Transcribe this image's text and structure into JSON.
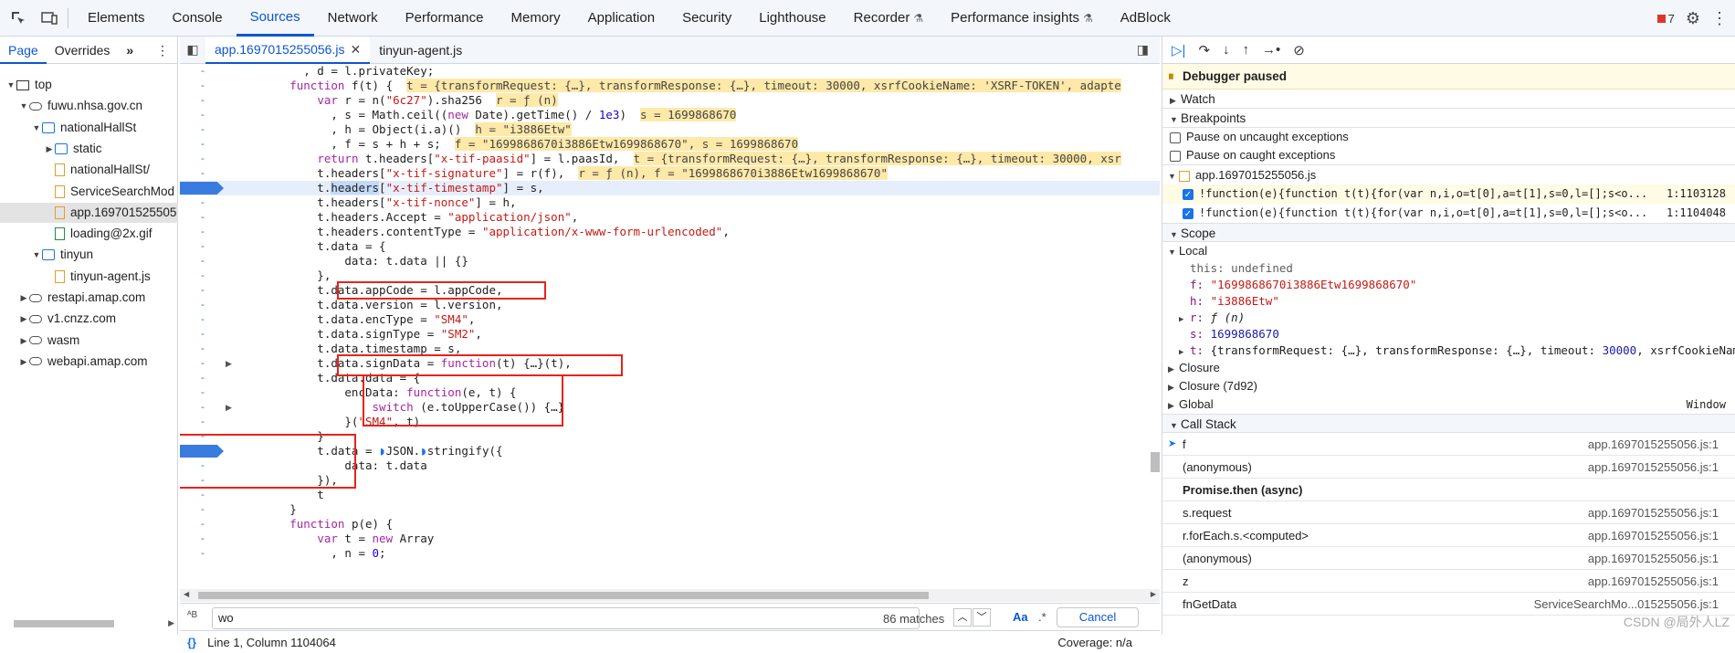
{
  "toolbar": {
    "tabs": [
      "Elements",
      "Console",
      "Sources",
      "Network",
      "Performance",
      "Memory",
      "Application",
      "Security",
      "Lighthouse",
      "Recorder",
      "Performance insights",
      "AdBlock"
    ],
    "active_tab": "Sources",
    "error_count": "7"
  },
  "navigator": {
    "tabs": [
      "Page",
      "Overrides"
    ],
    "tree": [
      {
        "label": "top",
        "indent": 0,
        "icon": "frame",
        "arrow": "▼"
      },
      {
        "label": "fuwu.nhsa.gov.cn",
        "indent": 1,
        "icon": "cloud",
        "arrow": "▼"
      },
      {
        "label": "nationalHallSt",
        "indent": 2,
        "icon": "folder",
        "arrow": "▼"
      },
      {
        "label": "static",
        "indent": 3,
        "icon": "folder",
        "arrow": "▶"
      },
      {
        "label": "nationalHallSt/",
        "indent": 3,
        "icon": "file",
        "arrow": ""
      },
      {
        "label": "ServiceSearchMod",
        "indent": 3,
        "icon": "file",
        "arrow": ""
      },
      {
        "label": "app.169701525505",
        "indent": 3,
        "icon": "file",
        "arrow": "",
        "selected": true
      },
      {
        "label": "loading@2x.gif",
        "indent": 3,
        "icon": "filegreen",
        "arrow": ""
      },
      {
        "label": "tinyun",
        "indent": 2,
        "icon": "folder",
        "arrow": "▼"
      },
      {
        "label": "tinyun-agent.js",
        "indent": 3,
        "icon": "file",
        "arrow": ""
      },
      {
        "label": "restapi.amap.com",
        "indent": 1,
        "icon": "cloud",
        "arrow": "▶"
      },
      {
        "label": "v1.cnzz.com",
        "indent": 1,
        "icon": "cloud",
        "arrow": "▶"
      },
      {
        "label": "wasm",
        "indent": 1,
        "icon": "cloud",
        "arrow": "▶"
      },
      {
        "label": "webapi.amap.com",
        "indent": 1,
        "icon": "cloud",
        "arrow": "▶"
      }
    ]
  },
  "editor": {
    "tabs": [
      "app.1697015255056.js",
      "tinyun-agent.js"
    ],
    "search": {
      "value": "wo",
      "matches": "86 matches",
      "case_label": "Aa",
      "regex_label": ".*",
      "cancel": "Cancel"
    },
    "status": {
      "position": "Line 1, Column 1104064",
      "coverage": "Coverage: n/a"
    }
  },
  "debugger": {
    "paused": "Debugger paused",
    "sections": {
      "watch": "Watch",
      "breakpoints": "Breakpoints",
      "scope": "Scope",
      "local": "Local",
      "closure": "Closure",
      "closure2": "Closure (7d92)",
      "global": "Global",
      "global_value": "Window",
      "callstack": "Call Stack"
    },
    "pause_uncaught": "Pause on uncaught exceptions",
    "pause_caught": "Pause on caught exceptions",
    "bp_file": "app.1697015255056.js",
    "breakpoints": [
      {
        "code": "!function(e){function t(t){for(var n,i,o=t[0],a=t[1],s=0,l=[];s<o...",
        "loc": "1:1103128"
      },
      {
        "code": "!function(e){function t(t){for(var n,i,o=t[0],a=t[1],s=0,l=[];s<o...",
        "loc": "1:1104048"
      }
    ],
    "scope": {
      "this_key": "this:",
      "this_val": "undefined",
      "f_key": "f:",
      "f_val": "\"1699868670i3886Etw1699868670\"",
      "h_key": "h:",
      "h_val": "\"i3886Etw\"",
      "r_key": "r:",
      "r_val": "ƒ (n)",
      "s_key": "s:",
      "s_val": "1699868670",
      "t_key": "t:",
      "t_val": "{transformRequest: {…}, transformResponse: {…}, timeout: ",
      "t_num": "30000",
      "t_tail": ", xsrfCookieName"
    },
    "callstack": [
      {
        "fn": "f",
        "loc": "app.1697015255056.js:1",
        "current": true
      },
      {
        "fn": "(anonymous)",
        "loc": "app.1697015255056.js:1"
      },
      {
        "fn": "Promise.then (async)",
        "loc": "",
        "async": true
      },
      {
        "fn": "s.request",
        "loc": "app.1697015255056.js:1"
      },
      {
        "fn": "r.forEach.s.<computed>",
        "loc": "app.1697015255056.js:1"
      },
      {
        "fn": "(anonymous)",
        "loc": "app.1697015255056.js:1"
      },
      {
        "fn": "z",
        "loc": "app.1697015255056.js:1"
      },
      {
        "fn": "fnGetData",
        "loc": "ServiceSearchMo...015255056.js:1"
      }
    ],
    "watermark": "CSDN @局外人LZ"
  }
}
